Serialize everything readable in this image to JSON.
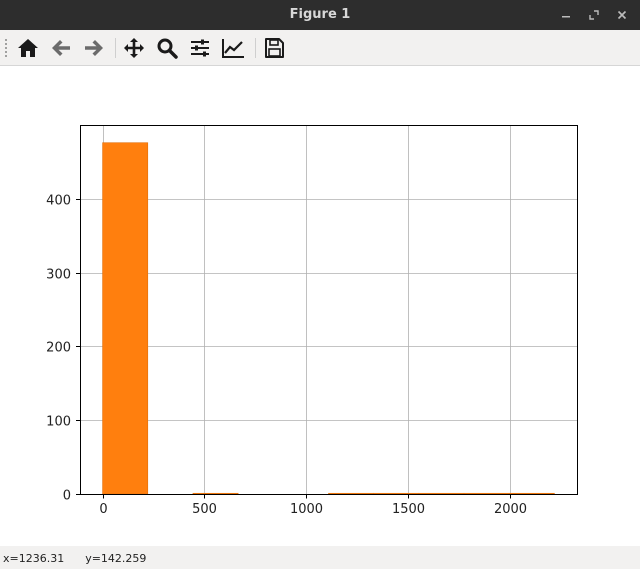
{
  "window": {
    "title": "Figure 1"
  },
  "toolbar": {
    "tools": [
      {
        "name": "home",
        "icon": "home-icon"
      },
      {
        "name": "back",
        "icon": "arrow-left-icon"
      },
      {
        "name": "forward",
        "icon": "arrow-right-icon"
      },
      {
        "name": "pan",
        "icon": "move-icon"
      },
      {
        "name": "zoom",
        "icon": "zoom-icon"
      },
      {
        "name": "configure-subplots",
        "icon": "sliders-icon"
      },
      {
        "name": "edit-axis",
        "icon": "line-chart-icon"
      },
      {
        "name": "save",
        "icon": "save-icon"
      }
    ]
  },
  "status": {
    "x": "x=1236.31",
    "y": "y=142.259"
  },
  "chart_data": {
    "type": "bar",
    "subtype": "histogram",
    "bins": [
      {
        "x0": 0,
        "x1": 222,
        "count": 476
      },
      {
        "x0": 444,
        "x1": 666,
        "count": 1
      },
      {
        "x0": 1110,
        "x1": 1332,
        "count": 1
      },
      {
        "x0": 1332,
        "x1": 1554,
        "count": 1
      },
      {
        "x0": 1554,
        "x1": 1776,
        "count": 1
      },
      {
        "x0": 1776,
        "x1": 1998,
        "count": 1
      },
      {
        "x0": 1998,
        "x1": 2220,
        "count": 1
      }
    ],
    "xlim": [
      -111,
      2331
    ],
    "ylim": [
      0,
      500
    ],
    "xticks": [
      0,
      500,
      1000,
      1500,
      2000
    ],
    "yticks": [
      0,
      100,
      200,
      300,
      400
    ],
    "grid": true,
    "colors": {
      "bar": "#ff7f0e",
      "bar_edge": "#e0700c",
      "grid": "#b0b0b0"
    }
  }
}
